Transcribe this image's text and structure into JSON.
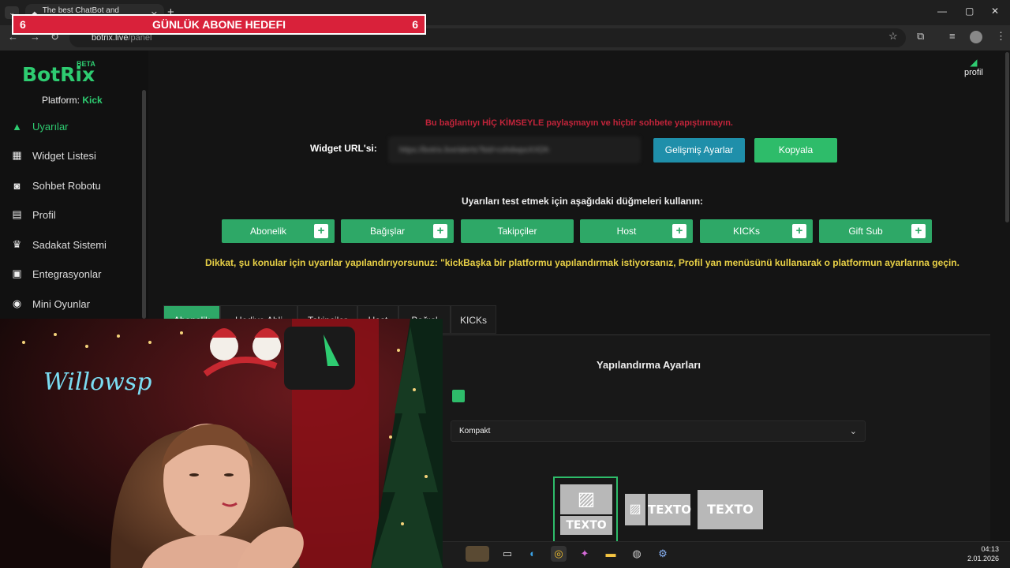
{
  "browser": {
    "tab_title": "The best ChatBot and Widgets",
    "url_host": "botrix.live",
    "url_path": "/panel"
  },
  "overlay": {
    "goal_left": "6",
    "goal_title": "GÜNLÜK ABONE HEDEFI",
    "goal_right": "6"
  },
  "app": {
    "logo": "BotRix",
    "beta": "BETA",
    "platform_label": "Platform:",
    "platform_value": "Kick",
    "profile_label": "profil"
  },
  "sidebar": {
    "items": [
      {
        "label": "Uyarılar",
        "icon": "warning-icon"
      },
      {
        "label": "Widget Listesi",
        "icon": "grid-icon"
      },
      {
        "label": "Sohbet Robotu",
        "icon": "robot-icon"
      },
      {
        "label": "Profil",
        "icon": "id-card-icon"
      },
      {
        "label": "Sadakat Sistemi",
        "icon": "trophy-icon"
      },
      {
        "label": "Entegrasyonlar",
        "icon": "integration-icon"
      },
      {
        "label": "Mini Oyunlar",
        "icon": "gamepad-icon"
      }
    ]
  },
  "main": {
    "warning": "Bu bağlantıyı HİÇ KİMSEYLE paylaşmayın ve hiçbir sohbete yapıştırmayın.",
    "widget_url_label": "Widget URL'si:",
    "widget_url_value": "https://botrix.live/alerts?bid=cshdwpoXXDh",
    "advanced_button": "Gelişmiş Ayarlar",
    "copy_button": "Kopyala",
    "test_title": "Uyarıları test etmek için aşağıdaki düğmeleri kullanın:",
    "test_buttons": [
      "Abonelik",
      "Bağışlar",
      "Takipçiler",
      "Host",
      "KICKs",
      "Gift Sub"
    ],
    "caution": "Dikkat, şu konular için uyarılar yapılandırıyorsunuz: \"kickBaşka bir platformu yapılandırmak istiyorsanız, Profil yan menüsünü kullanarak o platformun ayarlarına geçin.",
    "tabs": [
      "Abonelik",
      "Hediye Abli",
      "Takipçiler",
      "Host",
      "Bağışl",
      "KICKs"
    ],
    "config_title": "Yapılandırma Ayarları",
    "layout_select": "Kompakt",
    "thumb_text": "TEXTO"
  },
  "taskbar": {
    "time": "04:13",
    "date": "2.01.2026"
  },
  "colors": {
    "accent_green": "#2ecc71",
    "button_green": "#2ea867",
    "button_blue": "#1f8faa",
    "warning_red": "#c0243a",
    "caution_yellow": "#e8d046",
    "goal_red": "#d9213a"
  }
}
